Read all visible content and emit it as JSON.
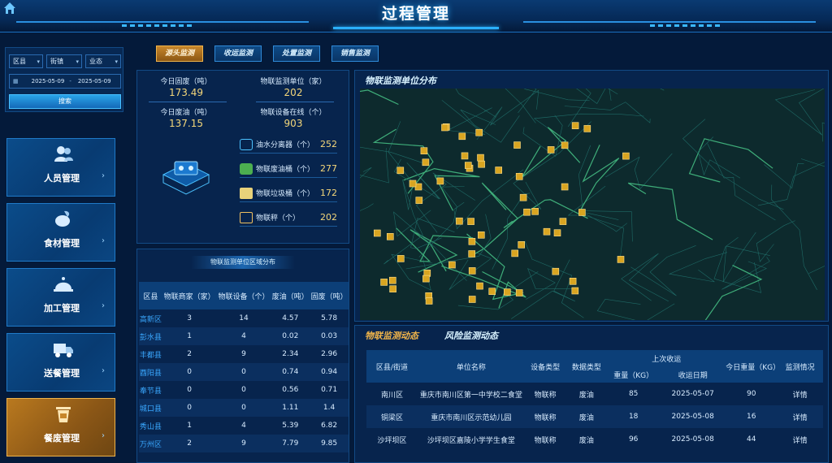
{
  "header": {
    "title": "过程管理"
  },
  "filters": {
    "district": "区县",
    "street": "街镇",
    "business_type": "业态",
    "date_start": "2025-05-09",
    "date_end": "2025-05-09",
    "search_label": "搜索"
  },
  "nav": {
    "items": [
      {
        "label": "人员管理",
        "icon": "users-icon"
      },
      {
        "label": "食材管理",
        "icon": "ingredients-icon"
      },
      {
        "label": "加工管理",
        "icon": "cloche-icon"
      },
      {
        "label": "送餐管理",
        "icon": "delivery-truck-icon"
      },
      {
        "label": "餐废管理",
        "icon": "waste-bin-icon"
      }
    ],
    "active_index": 4
  },
  "tabs": [
    {
      "label": "源头监测"
    },
    {
      "label": "收运监测"
    },
    {
      "label": "处置监测"
    },
    {
      "label": "销售监测"
    }
  ],
  "stats": {
    "solid_waste_label": "今日固废（吨）",
    "solid_waste_value": "173.49",
    "waste_oil_label": "今日废油（吨）",
    "waste_oil_value": "137.15",
    "iot_units_label": "物联监测单位（家）",
    "iot_units_value": "202",
    "iot_online_label": "物联设备在线（个）",
    "iot_online_value": "903",
    "devices": [
      {
        "label": "油水分离器（个）",
        "value": "252"
      },
      {
        "label": "物联废油桶（个）",
        "value": "277"
      },
      {
        "label": "物联垃圾桶（个）",
        "value": "172"
      },
      {
        "label": "物联秤（个）",
        "value": "202"
      }
    ]
  },
  "region": {
    "title": "物联监测单位区域分布",
    "headers": [
      "区县",
      "物联商家（家）",
      "物联设备（个）",
      "废油（吨）",
      "固废（吨）"
    ],
    "rows": [
      [
        "高新区",
        "3",
        "14",
        "4.57",
        "5.78"
      ],
      [
        "彭水县",
        "1",
        "4",
        "0.02",
        "0.03"
      ],
      [
        "丰都县",
        "2",
        "9",
        "2.34",
        "2.96"
      ],
      [
        "酉阳县",
        "0",
        "0",
        "0.74",
        "0.94"
      ],
      [
        "奉节县",
        "0",
        "0",
        "0.56",
        "0.71"
      ],
      [
        "城口县",
        "0",
        "0",
        "1.11",
        "1.4"
      ],
      [
        "秀山县",
        "1",
        "4",
        "5.39",
        "6.82"
      ],
      [
        "万州区",
        "2",
        "9",
        "7.79",
        "9.85"
      ]
    ]
  },
  "map": {
    "title": "物联监测单位分布"
  },
  "dynamic": {
    "tab_active": "物联监测动态",
    "tab_other": "风险监测动态",
    "headers": {
      "district": "区县/街道",
      "unit": "单位名称",
      "device_type": "设备类型",
      "data_type": "数据类型",
      "last_collect": "上次收运",
      "weight": "重量（KG）",
      "date": "收运日期",
      "today_weight": "今日重量（KG）",
      "status": "监测情况"
    },
    "rows": [
      {
        "district": "南川区",
        "unit": "重庆市南川区第一中学校二食堂",
        "device_type": "物联称",
        "data_type": "废油",
        "weight": "85",
        "date": "2025-05-07",
        "today": "90",
        "status": "详情"
      },
      {
        "district": "铜梁区",
        "unit": "重庆市南川区示范幼儿园",
        "device_type": "物联称",
        "data_type": "废油",
        "weight": "18",
        "date": "2025-05-08",
        "today": "16",
        "status": "详情"
      },
      {
        "district": "沙坪坝区",
        "unit": "沙坪坝区嘉陵小学学生食堂",
        "device_type": "物联称",
        "data_type": "废油",
        "weight": "96",
        "date": "2025-05-08",
        "today": "44",
        "status": "详情"
      }
    ]
  },
  "colors": {
    "accent": "#3aa8ff",
    "value": "#f4d77a",
    "active_gold": "#c7862b"
  }
}
